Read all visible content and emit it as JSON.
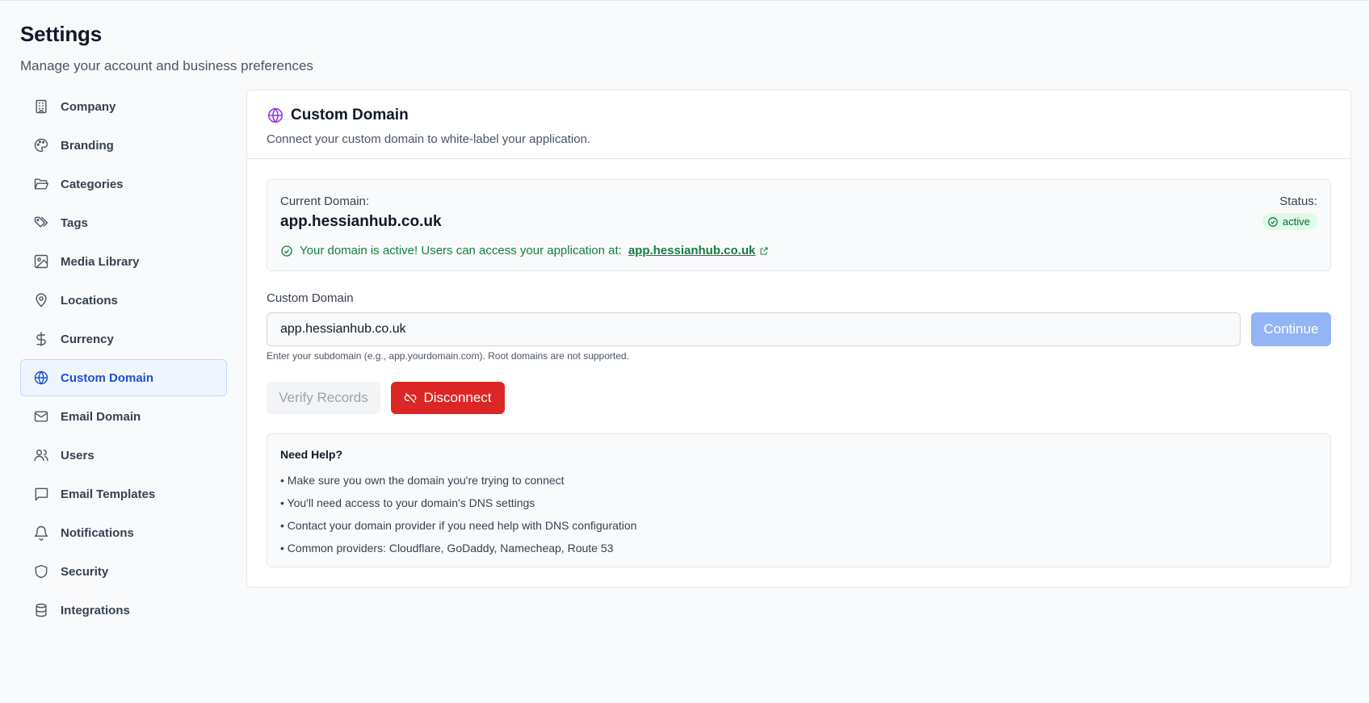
{
  "header": {
    "title": "Settings",
    "subtitle": "Manage your account and business preferences"
  },
  "sidebar": {
    "items": [
      {
        "label": "Company",
        "icon": "building-icon"
      },
      {
        "label": "Branding",
        "icon": "palette-icon"
      },
      {
        "label": "Categories",
        "icon": "folder-open-icon"
      },
      {
        "label": "Tags",
        "icon": "tags-icon"
      },
      {
        "label": "Media Library",
        "icon": "image-icon"
      },
      {
        "label": "Locations",
        "icon": "map-pin-icon"
      },
      {
        "label": "Currency",
        "icon": "dollar-sign-icon"
      },
      {
        "label": "Custom Domain",
        "icon": "globe-icon",
        "active": true
      },
      {
        "label": "Email Domain",
        "icon": "mail-icon"
      },
      {
        "label": "Users",
        "icon": "users-icon"
      },
      {
        "label": "Email Templates",
        "icon": "message-square-icon"
      },
      {
        "label": "Notifications",
        "icon": "bell-icon"
      },
      {
        "label": "Security",
        "icon": "shield-icon"
      },
      {
        "label": "Integrations",
        "icon": "database-icon"
      }
    ]
  },
  "card": {
    "title": "Custom Domain",
    "description": "Connect your custom domain to white-label your application.",
    "current_domain_label": "Current Domain:",
    "current_domain_value": "app.hessianhub.co.uk",
    "status_label": "Status:",
    "status_value": "active",
    "active_message": "Your domain is active! Users can access your application at:",
    "active_link": "app.hessianhub.co.uk",
    "field_label": "Custom Domain",
    "input_value": "app.hessianhub.co.uk",
    "continue_label": "Continue",
    "hint": "Enter your subdomain (e.g., app.yourdomain.com). Root domains are not supported.",
    "verify_label": "Verify Records",
    "disconnect_label": "Disconnect",
    "help_title": "Need Help?",
    "help_items": [
      "• Make sure you own the domain you're trying to connect",
      "• You'll need access to your domain's DNS settings",
      "• Contact your domain provider if you need help with DNS configuration",
      "• Common providers: Cloudflare, GoDaddy, Namecheap, Route 53"
    ]
  },
  "colors": {
    "accent": "#1d4ed8",
    "success": "#15803d",
    "danger": "#dc2626",
    "globe": "#9333ea"
  }
}
